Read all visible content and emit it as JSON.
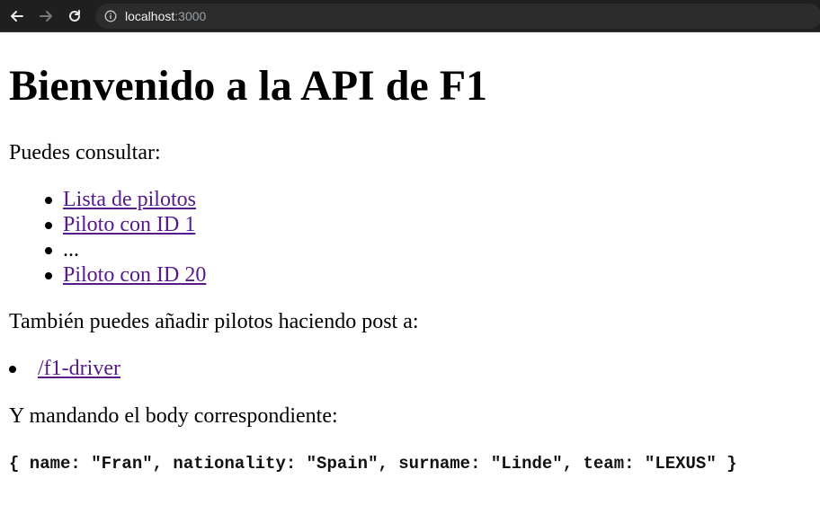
{
  "browser": {
    "url_host": "localhost",
    "url_port": ":3000",
    "back_icon": "arrow-left-icon",
    "forward_icon": "arrow-right-icon",
    "reload_icon": "reload-icon",
    "info_icon": "info-icon",
    "colors": {
      "toolbar": "#1f1f1f",
      "omnibox": "#2c2c2c",
      "link": "#551a8b"
    }
  },
  "page": {
    "title": "Bienvenido a la API de F1",
    "intro": "Puedes consultar:",
    "links": [
      {
        "label": "Lista de pilotos"
      },
      {
        "label": "Piloto con ID 1"
      },
      {
        "label": "..."
      },
      {
        "label": "Piloto con ID 20"
      }
    ],
    "post_intro": "También puedes añadir pilotos haciendo post a:",
    "post_link": "/f1-driver",
    "body_intro": "Y mandando el body correspondiente:",
    "body_example": "{ name: \"Fran\", nationality: \"Spain\", surname: \"Linde\", team: \"LEXUS\" }"
  }
}
